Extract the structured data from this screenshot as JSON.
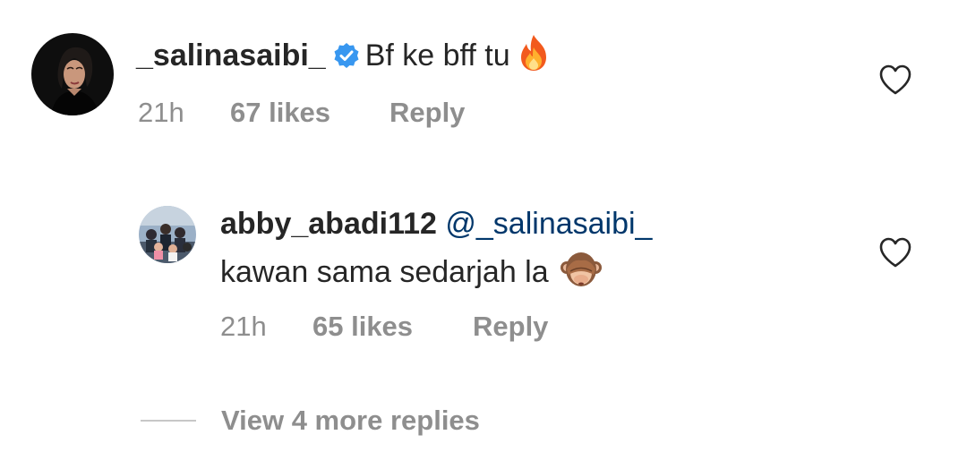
{
  "comments": [
    {
      "username": "_salinasaibi_",
      "verified": true,
      "text": "Bf ke bff tu",
      "emoji": "fire-emoji",
      "time": "21h",
      "likes": "67 likes",
      "reply_label": "Reply"
    },
    {
      "username": "abby_abadi112",
      "verified": false,
      "mention": "@_salinasaibi_",
      "text": "kawan sama sedarjah la",
      "emoji": "see-no-evil-monkey-emoji",
      "time": "21h",
      "likes": "65 likes",
      "reply_label": "Reply"
    }
  ],
  "view_more_replies": "View 4 more replies",
  "colors": {
    "text": "#262626",
    "secondary": "#8e8e8e",
    "mention": "#00376b",
    "verified": "#3897f0"
  },
  "icons": {
    "like": "heart-outline-icon",
    "verified": "verified-badge-icon"
  }
}
